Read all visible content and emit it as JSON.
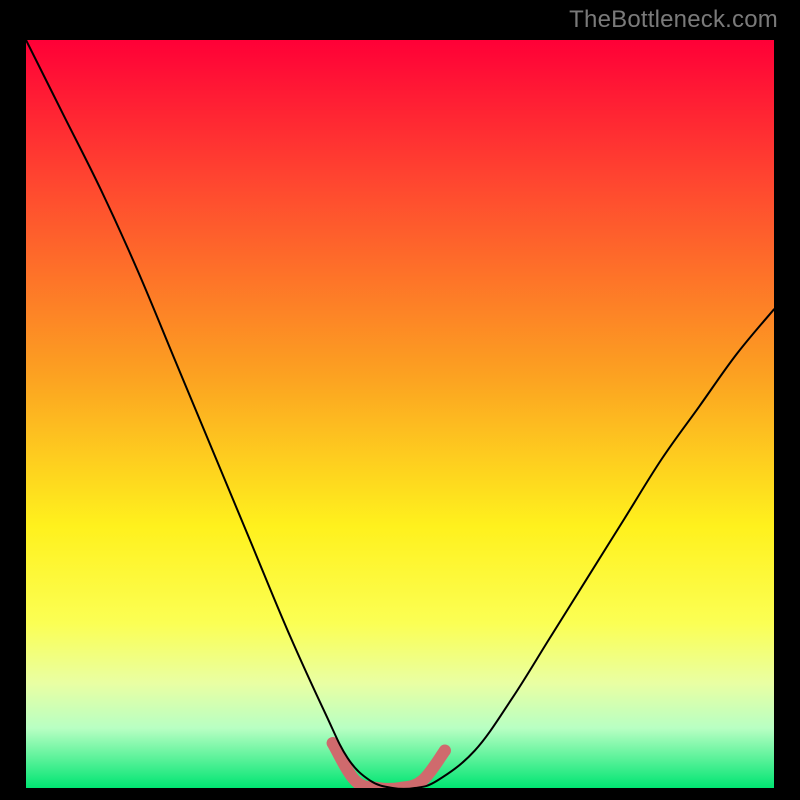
{
  "watermark": "TheBottleneck.com",
  "chart_data": {
    "type": "line",
    "title": "",
    "xlabel": "",
    "ylabel": "",
    "xlim": [
      0,
      100
    ],
    "ylim": [
      0,
      100
    ],
    "grid": false,
    "legend": false,
    "background": {
      "type": "vertical-gradient",
      "stops": [
        {
          "pos": 0.0,
          "color": "#ff0037"
        },
        {
          "pos": 0.2,
          "color": "#ff4a2f"
        },
        {
          "pos": 0.45,
          "color": "#fca221"
        },
        {
          "pos": 0.65,
          "color": "#fff11d"
        },
        {
          "pos": 0.78,
          "color": "#fbff54"
        },
        {
          "pos": 0.86,
          "color": "#e9ffa3"
        },
        {
          "pos": 0.92,
          "color": "#b8ffc3"
        },
        {
          "pos": 1.0,
          "color": "#00e572"
        }
      ]
    },
    "series": [
      {
        "name": "bottleneck-curve",
        "color": "#000000",
        "x": [
          0,
          5,
          10,
          15,
          20,
          25,
          30,
          35,
          40,
          43,
          46,
          49,
          52,
          55,
          60,
          65,
          70,
          75,
          80,
          85,
          90,
          95,
          100
        ],
        "y": [
          100,
          90,
          80,
          69,
          57,
          45,
          33,
          21,
          10,
          4,
          1,
          0,
          0,
          1,
          5,
          12,
          20,
          28,
          36,
          44,
          51,
          58,
          64
        ]
      },
      {
        "name": "highlight-band",
        "color": "#cf6a6d",
        "stroke_width": 12,
        "x": [
          41,
          44,
          47,
          50,
          53,
          56
        ],
        "y": [
          6,
          1,
          0,
          0,
          1,
          5
        ]
      }
    ]
  }
}
